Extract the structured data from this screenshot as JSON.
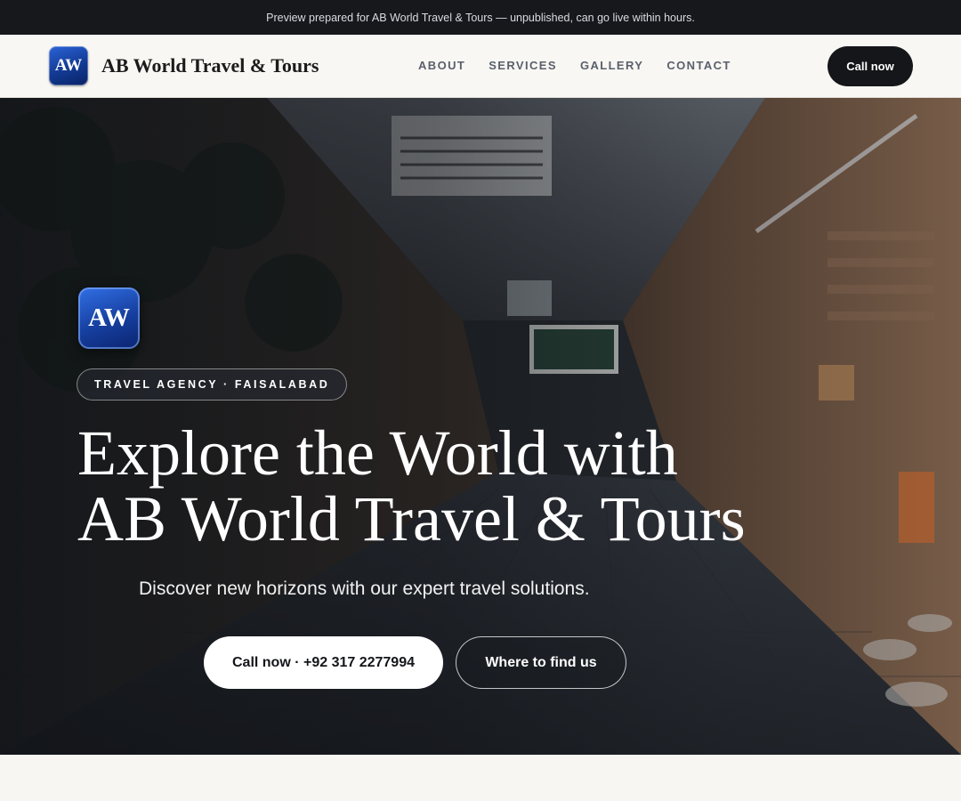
{
  "preview_banner": "Preview prepared for AB World Travel & Tours — unpublished, can go live within hours.",
  "header": {
    "logo_text": "AW",
    "brand_name": "AB World Travel & Tours",
    "nav": [
      "ABOUT",
      "SERVICES",
      "GALLERY",
      "CONTACT"
    ],
    "call_button": "Call now"
  },
  "hero": {
    "logo_text": "AW",
    "eyebrow": "TRAVEL AGENCY · FAISALABAD",
    "title_line1": "Explore the World with",
    "title_line2": "AB World Travel & Tours",
    "subtitle": "Discover new horizons with our expert travel solutions.",
    "primary_button": "Call now · +92 317 2277994",
    "secondary_button": "Where to find us",
    "background_icon": "market-alley-photo"
  },
  "colors": {
    "dark": "#15161a",
    "logo_blue": "#163f9f",
    "page_bg": "#f7f6f2"
  }
}
